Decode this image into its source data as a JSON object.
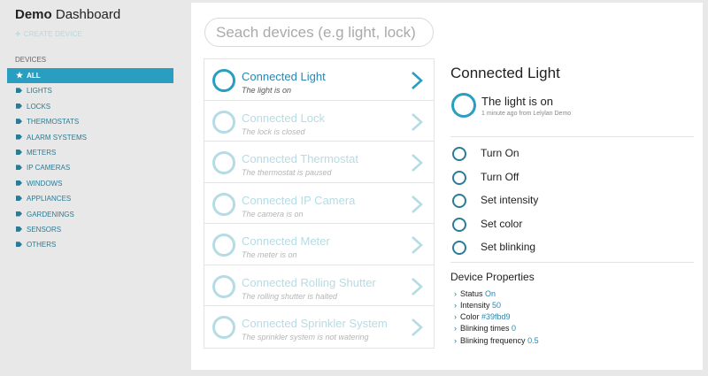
{
  "brand": {
    "bold": "Demo",
    "rest": " Dashboard"
  },
  "sidebar": {
    "create_label": "CREATE DEVICE",
    "devices_heading": "DEVICES",
    "items": [
      {
        "label": "ALL",
        "active": true
      },
      {
        "label": "LIGHTS"
      },
      {
        "label": "LOCKS"
      },
      {
        "label": "THERMOSTATS"
      },
      {
        "label": "ALARM SYSTEMS"
      },
      {
        "label": "METERS"
      },
      {
        "label": "IP CAMERAS"
      },
      {
        "label": "WINDOWS"
      },
      {
        "label": "APPLIANCES"
      },
      {
        "label": "GARDENINGS"
      },
      {
        "label": "SENSORS"
      },
      {
        "label": "OTHERS"
      }
    ]
  },
  "search": {
    "placeholder": "Seach devices (e.g light, lock)"
  },
  "devices": [
    {
      "title": "Connected Light",
      "status": "The light is on",
      "selected": true
    },
    {
      "title": "Connected Lock",
      "status": "The lock is closed"
    },
    {
      "title": "Connected Thermostat",
      "status": "The thermostat is paused"
    },
    {
      "title": "Connected IP Camera",
      "status": "The camera is on"
    },
    {
      "title": "Connected Meter",
      "status": "The meter is on"
    },
    {
      "title": "Connected Rolling Shutter",
      "status": "The rolling shutter is halted"
    },
    {
      "title": "Connected Sprinkler System",
      "status": "The sprinkler system is not watering"
    }
  ],
  "detail": {
    "title": "Connected Light",
    "state_text": "The light is on",
    "state_meta": "1 minute ago from Lelylan Demo",
    "functions": [
      "Turn On",
      "Turn Off",
      "Set intensity",
      "Set color",
      "Set blinking"
    ],
    "properties_heading": "Device Properties",
    "properties": [
      {
        "name": "Status",
        "value": "On"
      },
      {
        "name": "Intensity",
        "value": "50"
      },
      {
        "name": "Color",
        "value": "#39fbd9"
      },
      {
        "name": "Blinking times",
        "value": "0"
      },
      {
        "name": "Blinking frequency",
        "value": "0.5"
      }
    ]
  },
  "colors": {
    "accent": "#2a9ec1",
    "link": "#2a7b95",
    "faded": "#b5dce5"
  }
}
